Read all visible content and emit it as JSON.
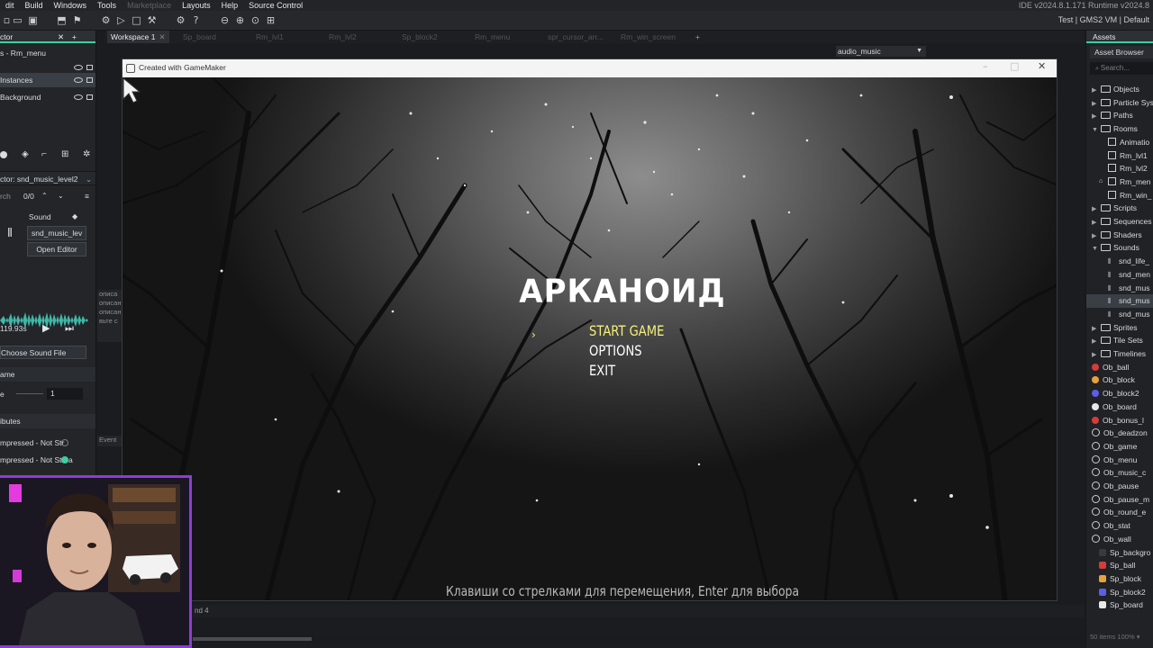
{
  "menubar": {
    "items": [
      "dit",
      "Build",
      "Windows",
      "Tools",
      "Marketplace",
      "Layouts",
      "Help",
      "Source Control"
    ],
    "version": "IDE v2024.8.1.171  Runtime v2024.8"
  },
  "toolbar": {
    "target": "Test | GMS2 VM | Default"
  },
  "left_panel": {
    "tab_label": "ctor",
    "room_row": "s - Rm_menu",
    "layers": [
      "Instances",
      "Background"
    ],
    "inspector_title": "ctor: snd_music_level2",
    "search_count": "0/0",
    "sound_label": "Sound",
    "sound_name": "snd_music_lev",
    "open_editor": "Open Editor",
    "duration": "119.93s",
    "choose_file": "Choose Sound File",
    "name_section": "ame",
    "volume_label": "e",
    "volume_value": "1",
    "attributes": "ibutes",
    "compress1": "mpressed - Not Str",
    "compress2": "mpressed - Not Strea"
  },
  "bg_fragments": {
    "desc": [
      "описа",
      "описан",
      "описан",
      "вьте с"
    ],
    "event": "Event"
  },
  "workspace": {
    "tabs": [
      "Workspace 1",
      "Sp_board",
      "Rm_lvl1",
      "Rm_lvl2",
      "Sp_block2",
      "Rm_menu",
      "spr_cursor_arr...",
      "Rm_win_screen"
    ],
    "plus": "+",
    "audio_select": "audio_music"
  },
  "game_window": {
    "title": "Created with GameMaker",
    "game_title": "АРКАНОИД",
    "menu": [
      {
        "label": "START GAME",
        "color": "#f5f07a"
      },
      {
        "label": "OPTIONS",
        "color": "#ffffff"
      },
      {
        "label": "EXIT",
        "color": "#ffffff"
      }
    ],
    "selector": "›",
    "hint": "Клавиши со стрелками для перемещения, Enter для выбора"
  },
  "right_panel": {
    "tab_label": "Assets",
    "browser_label": "Asset Browser",
    "search_placeholder": "Search...",
    "tree": [
      {
        "label": "Objects",
        "kind": "group",
        "open": false
      },
      {
        "label": "Particle Syste",
        "kind": "group",
        "open": false
      },
      {
        "label": "Paths",
        "kind": "group",
        "open": false
      },
      {
        "label": "Rooms",
        "kind": "group",
        "open": true
      },
      {
        "label": "Animatio",
        "kind": "anim"
      },
      {
        "label": "Rm_lvl1",
        "kind": "room"
      },
      {
        "label": "Rm_lvl2",
        "kind": "room"
      },
      {
        "label": "Rm_men",
        "kind": "room",
        "home": true
      },
      {
        "label": "Rm_win_",
        "kind": "room"
      },
      {
        "label": "Scripts",
        "kind": "group",
        "open": false
      },
      {
        "label": "Sequences",
        "kind": "group",
        "open": false
      },
      {
        "label": "Shaders",
        "kind": "group",
        "open": false
      },
      {
        "label": "Sounds",
        "kind": "group",
        "open": true
      },
      {
        "label": "snd_life_",
        "kind": "sound"
      },
      {
        "label": "snd_men",
        "kind": "sound"
      },
      {
        "label": "snd_mus",
        "kind": "sound"
      },
      {
        "label": "snd_mus",
        "kind": "sound",
        "selected": true
      },
      {
        "label": "snd_mus",
        "kind": "sound"
      },
      {
        "label": "Sprites",
        "kind": "group",
        "open": false
      },
      {
        "label": "Tile Sets",
        "kind": "group",
        "open": false
      },
      {
        "label": "Timelines",
        "kind": "group",
        "open": false
      },
      {
        "label": "Ob_ball",
        "kind": "obj",
        "color": "#d63b3b"
      },
      {
        "label": "Ob_block",
        "kind": "obj",
        "color": "#e8a23c"
      },
      {
        "label": "Ob_block2",
        "kind": "obj",
        "color": "#5b5fe8"
      },
      {
        "label": "Ob_board",
        "kind": "obj",
        "color": "#e8e8e8"
      },
      {
        "label": "Ob_bonus_l",
        "kind": "obj",
        "color": "#d63b3b"
      },
      {
        "label": "Ob_deadzon",
        "kind": "objsq"
      },
      {
        "label": "Ob_game",
        "kind": "objsq"
      },
      {
        "label": "Ob_menu",
        "kind": "objsq"
      },
      {
        "label": "Ob_music_c",
        "kind": "objsq"
      },
      {
        "label": "Ob_pause",
        "kind": "objsq"
      },
      {
        "label": "Ob_pause_m",
        "kind": "objsq"
      },
      {
        "label": "Ob_round_e",
        "kind": "objsq"
      },
      {
        "label": "Ob_stat",
        "kind": "objsq"
      },
      {
        "label": "Ob_wall",
        "kind": "objsq"
      },
      {
        "label": "Sp_backgro",
        "kind": "spr",
        "color": "#3a3a3a"
      },
      {
        "label": "Sp_ball",
        "kind": "spr",
        "color": "#d63b3b"
      },
      {
        "label": "Sp_block",
        "kind": "spr",
        "color": "#e8a23c"
      },
      {
        "label": "Sp_block2",
        "kind": "spr",
        "color": "#5b5fe8"
      },
      {
        "label": "Sp_board",
        "kind": "spr",
        "color": "#e8e8e8"
      }
    ],
    "footer": "50 items  100%  ▾"
  },
  "status": {
    "bottom": "nd  4"
  }
}
